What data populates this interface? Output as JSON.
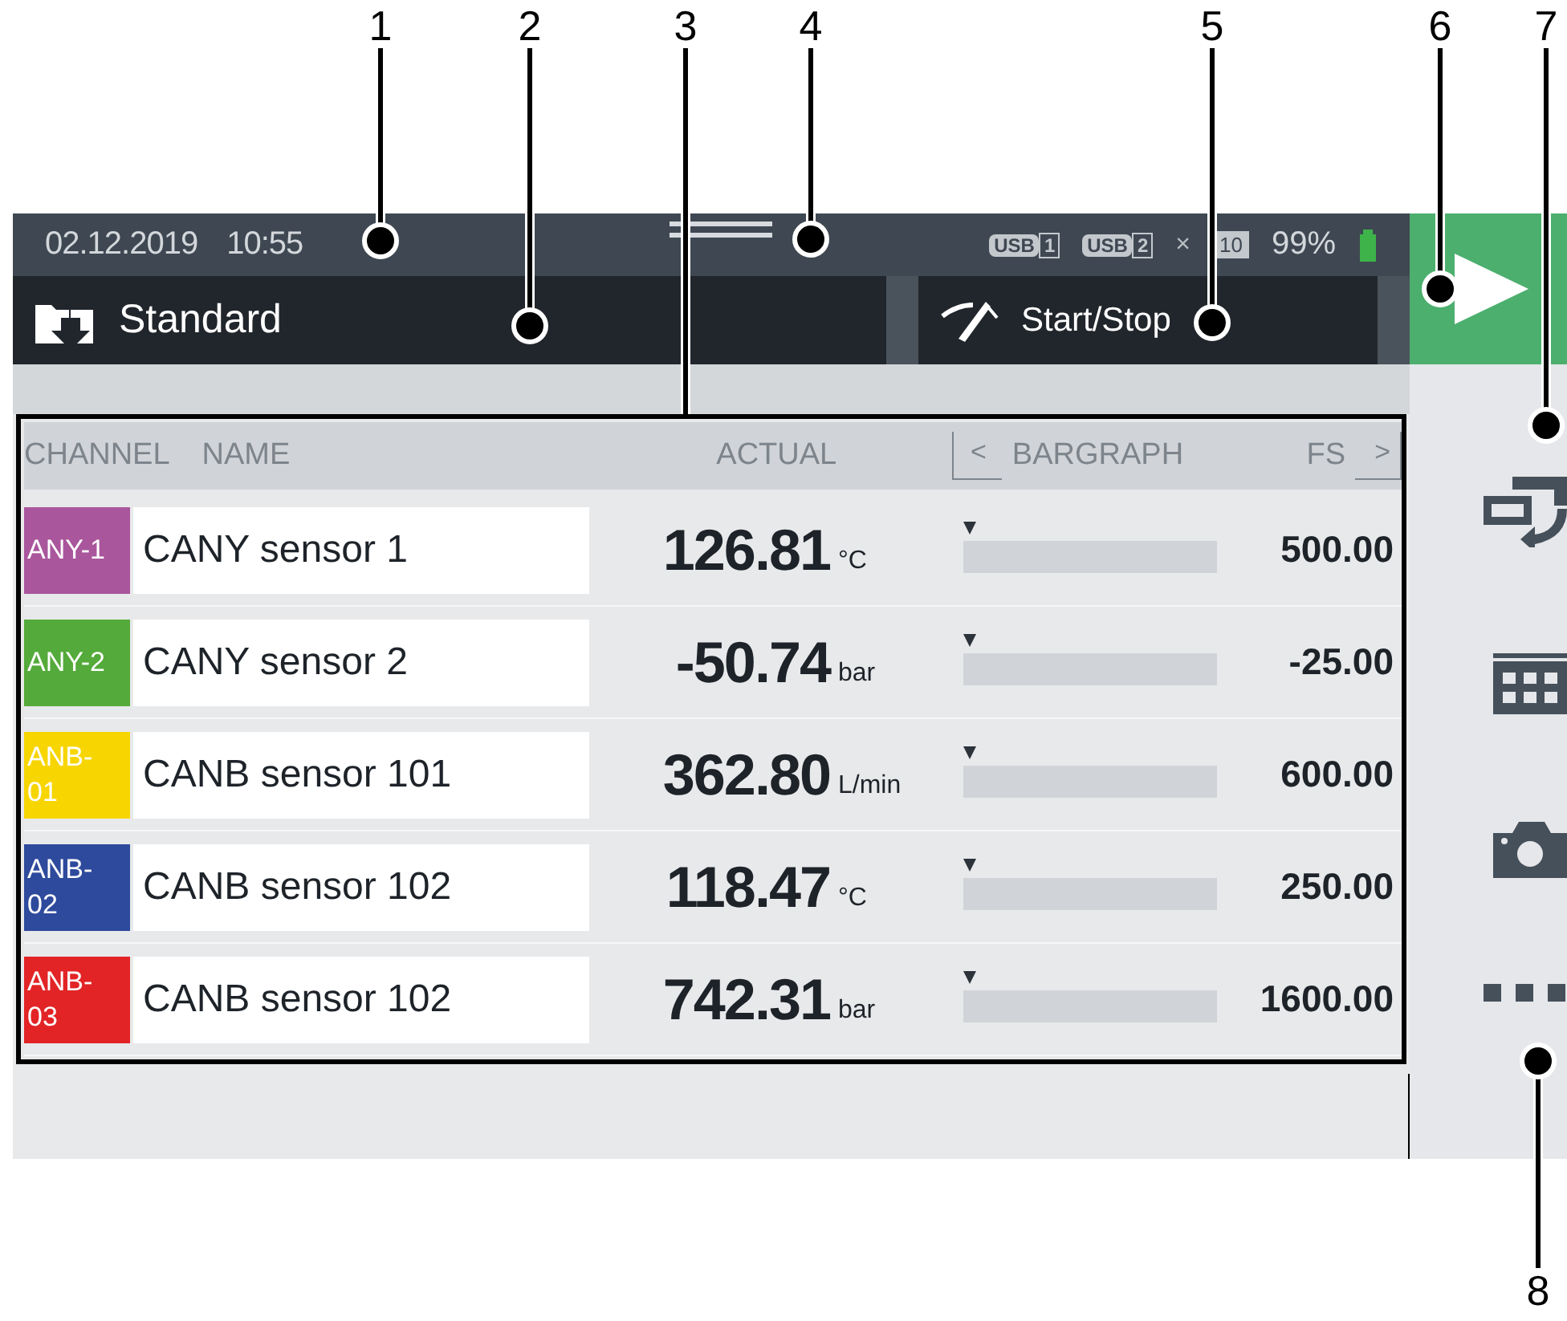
{
  "callouts": [
    "1",
    "2",
    "3",
    "4",
    "5",
    "6",
    "7",
    "8"
  ],
  "status_bar": {
    "date": "02.12.2019",
    "time": "10:55",
    "usb": [
      {
        "label": "USB",
        "number": "1"
      },
      {
        "label": "USB",
        "number": "2"
      }
    ],
    "mark": "×",
    "storage": "10",
    "battery": "99%"
  },
  "header": {
    "profile": "Standard",
    "start_stop": "Start/Stop"
  },
  "table": {
    "columns": [
      "CHANNEL",
      "NAME",
      "ACTUAL",
      "BARGRAPH",
      "FS"
    ],
    "prev": "<",
    "next": ">",
    "rows": [
      {
        "channel": "ANY-1",
        "color": "#a9569c",
        "name": "CANY sensor 1",
        "value": "126.81",
        "unit": "°C",
        "level": 0,
        "fs": "500.00"
      },
      {
        "channel": "ANY-2",
        "color": "#54aa3a",
        "name": "CANY sensor 2",
        "value": "-50.74",
        "unit": "bar",
        "level": 0,
        "fs": "-25.00"
      },
      {
        "channel": "ANB-01",
        "color": "#f7d500",
        "name": "CANB sensor 101",
        "value": "362.80",
        "unit": "L/min",
        "level": 0,
        "fs": "600.00"
      },
      {
        "channel": "ANB-02",
        "color": "#2e4a9c",
        "name": "CANB sensor 102",
        "value": "118.47",
        "unit": "°C",
        "level": 0,
        "fs": "250.00"
      },
      {
        "channel": "ANB-03",
        "color": "#e22426",
        "name": "CANB sensor 102",
        "value": "742.31",
        "unit": "bar",
        "level": 0,
        "fs": "1600.00"
      }
    ]
  }
}
